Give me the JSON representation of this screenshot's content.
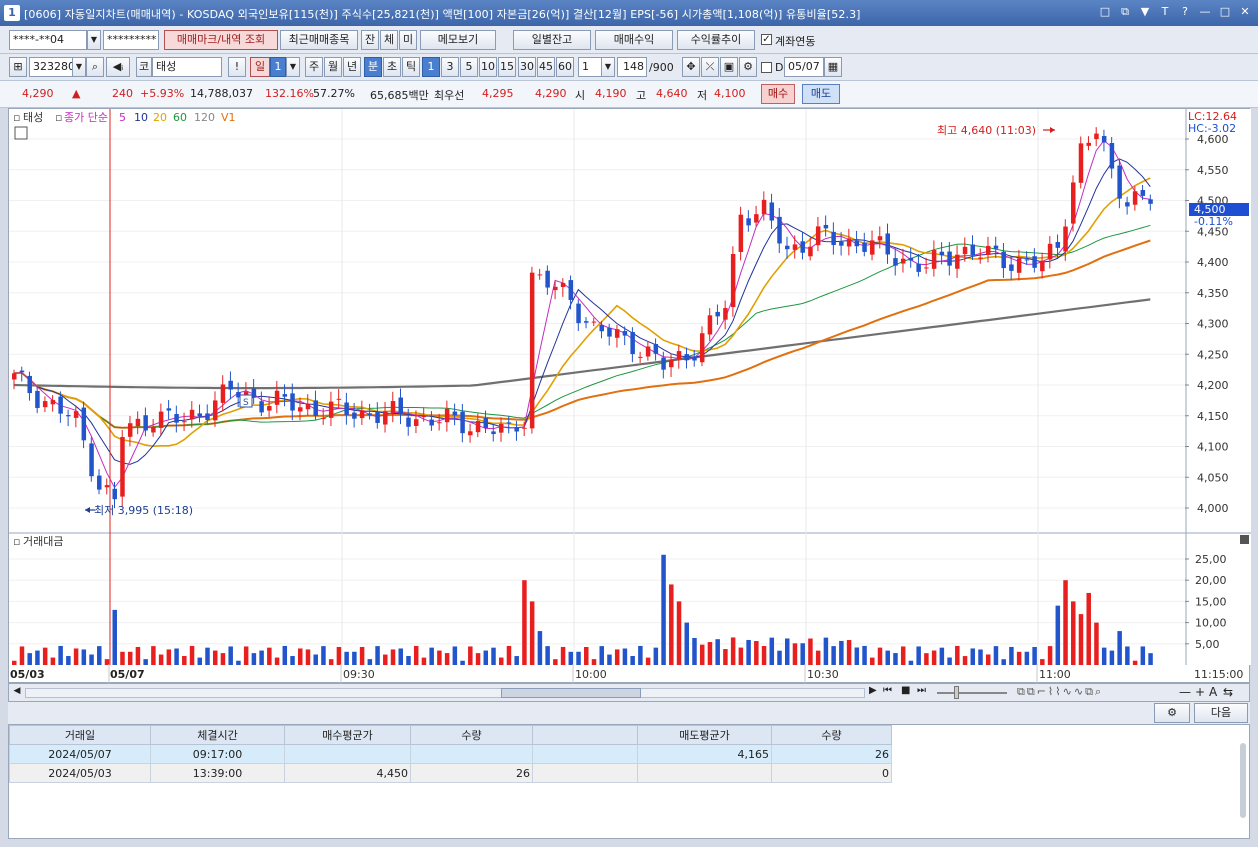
{
  "window": {
    "app_number": "1",
    "title": "[0606] 자동일지차트(매매내역) - KOSDAQ 외국인보유[115(천)] 주식수[25,821(천)] 액면[100] 자본금[26(억)] 결산[12월] EPS[-56] 시가총액[1,108(억)] 유통비율[52.3]",
    "buttons": [
      "□",
      "⧉",
      "▼",
      "T",
      "?",
      "—",
      "□",
      "✕"
    ]
  },
  "toolbar1": {
    "account": "****-**04",
    "password": "*********",
    "trade_mark_btn": "매매마크/내역 조회",
    "recent_btn": "최근매매종목",
    "mini1": "잔",
    "mini2": "체",
    "mini3": "미",
    "memo_btn": "메모보기",
    "daily_balance_btn": "일별잔고",
    "trade_profit_btn": "매매수익",
    "profit_trend_btn": "수익률추이",
    "account_link_label": "계좌연동",
    "account_link_checked": "✓"
  },
  "toolbar2": {
    "code": "323280",
    "market": "코",
    "stock_name": "태성",
    "exclaim": "!",
    "period_day": "일",
    "period_day_n": "1",
    "week": "주",
    "month": "월",
    "year": "년",
    "minute": "분",
    "second": "초",
    "tick": "틱",
    "intervals": [
      "1",
      "3",
      "5",
      "10",
      "15",
      "30",
      "45",
      "60"
    ],
    "interval_input": "1",
    "count": "148",
    "count_total": "/900",
    "d_label": "D",
    "date": "05/07"
  },
  "quote": {
    "price": "4,290",
    "arrow": "▲",
    "change": "240",
    "change_pct": "+5.93%",
    "volume": "14,788,037",
    "vol_ratio": "132.16%",
    "ratio2": "57.27%",
    "amount": "65,685백만",
    "best_label": "최우선",
    "best_ask": "4,295",
    "best_bid": "4,290",
    "open_label": "시",
    "open": "4,190",
    "high_label": "고",
    "high": "4,640",
    "low_label": "저",
    "low": "4,100",
    "buy_btn": "매수",
    "sell_btn": "매도"
  },
  "legend": {
    "stock": "태성",
    "ma_label": "종가 단순",
    "ma5": "5",
    "ma10": "10",
    "ma20": "20",
    "ma60": "60",
    "ma120": "120",
    "v1": "V1",
    "volume_title": "거래대금",
    "lc": "LC:12.64",
    "hc": "HC:-3.02"
  },
  "price_axis": [
    "4,600",
    "4,550",
    "4,500",
    "4,450",
    "4,400",
    "4,350",
    "4,300",
    "4,250",
    "4,200",
    "4,150",
    "4,100",
    "4,050",
    "4,000"
  ],
  "volume_axis": [
    "25,00",
    "20,00",
    "15,00",
    "10,00",
    "5,00"
  ],
  "annotations": {
    "high": "최고 4,640 (11:03)",
    "low": "최저 3,995 (15:18)",
    "current_price": "4,500",
    "current_pct": "-0.11%"
  },
  "time_axis": {
    "labels": [
      "05/03",
      "05/07",
      "09:30",
      "10:00",
      "10:30",
      "11:00"
    ],
    "end_time": "11:15:00"
  },
  "colors": {
    "up": "#e81f1f",
    "down": "#2255cc",
    "ma5": "#c42cc4",
    "ma10": "#223399",
    "ma20": "#e0a000",
    "ma60": "#1e9640",
    "ma120": "#e07010",
    "v1": "#707070"
  },
  "chart_data": {
    "type": "candlestick",
    "price_ylim": [
      3980,
      4640
    ],
    "volume_ylim": [
      0,
      27
    ],
    "high": {
      "value": 4640,
      "time": "11:03"
    },
    "low": {
      "value": 3995,
      "time": "15:18"
    },
    "current": 4500
  },
  "grid_bar": {
    "next_btn": "다음"
  },
  "grid": {
    "headers": [
      "거래일",
      "체결시간",
      "매수평균가",
      "수량",
      "",
      "매도평균가",
      "수량"
    ],
    "rows": [
      {
        "date": "2024/05/07",
        "time": "09:17:00",
        "buy_avg": "",
        "buy_qty": "",
        "blank": "",
        "sell_avg": "4,165",
        "sell_qty": "26"
      },
      {
        "date": "2024/05/03",
        "time": "13:39:00",
        "buy_avg": "4,450",
        "buy_qty": "26",
        "blank": "",
        "sell_avg": "",
        "sell_qty": "0"
      }
    ]
  }
}
